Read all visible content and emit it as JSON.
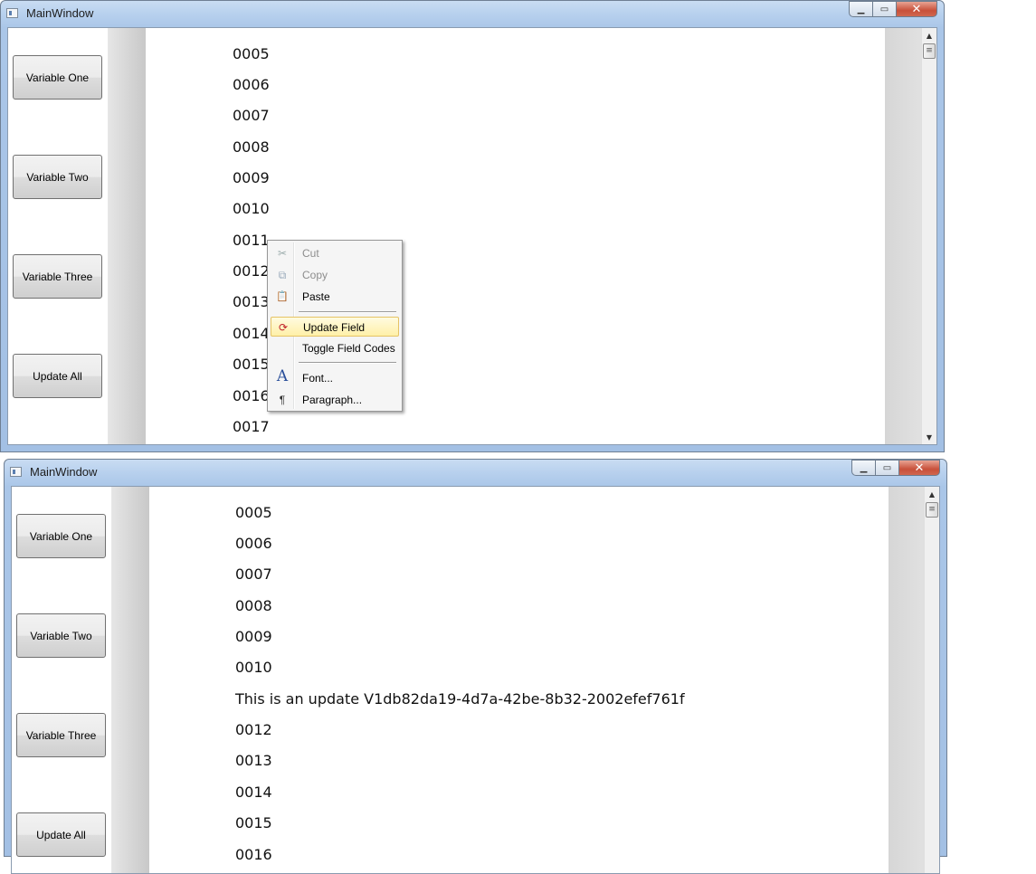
{
  "window_top": {
    "title": "MainWindow",
    "caption": {
      "minimize": "▁",
      "maximize": "▭",
      "close": "✕"
    },
    "buttons": [
      "Variable One",
      "Variable Two",
      "Variable Three",
      "Update All"
    ],
    "lines": [
      "0005",
      "0006",
      "0007",
      "0008",
      "0009",
      "0010",
      "0011",
      "0012",
      "0013",
      "0014",
      "0015",
      "0016",
      "0017"
    ],
    "context_menu": {
      "cut": "Cut",
      "copy": "Copy",
      "paste": "Paste",
      "update_field": "Update Field",
      "toggle_field_codes": "Toggle Field Codes",
      "font": "Font...",
      "paragraph": "Paragraph..."
    }
  },
  "window_bottom": {
    "title": "MainWindow",
    "caption": {
      "minimize": "▁",
      "maximize": "▭",
      "close": "✕"
    },
    "buttons": [
      "Variable One",
      "Variable Two",
      "Variable Three",
      "Update All"
    ],
    "lines": [
      "0005",
      "0006",
      "0007",
      "0008",
      "0009",
      "0010",
      "This is an update V1db82da19-4d7a-42be-8b32-2002efef761f",
      "0012",
      "0013",
      "0014",
      "0015",
      "0016"
    ]
  },
  "icons": {
    "scroll_up": "▲",
    "scroll_down": "▼",
    "thumb_grip": "≡",
    "cut": "✂",
    "copy": "⧉",
    "paste": "📋",
    "update_field": "⟳",
    "font": "A",
    "paragraph": "¶"
  },
  "colors": {
    "menu_highlight": "#fff0a8",
    "close_button": "#c8503a"
  }
}
